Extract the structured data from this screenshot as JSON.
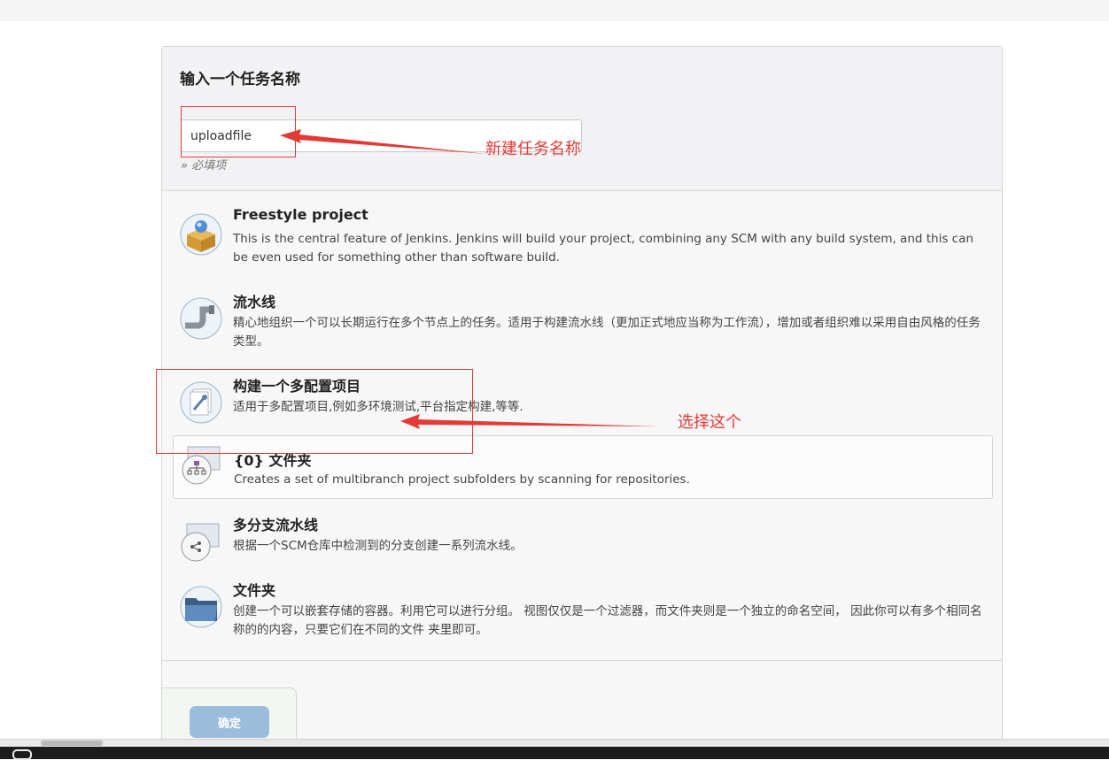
{
  "header": {
    "title": "输入一个任务名称",
    "name_value": "uploadfile",
    "required_hint": "» 必填项"
  },
  "project_types": [
    {
      "title": "Freestyle project",
      "description": "This is the central feature of Jenkins. Jenkins will build your project, combining any SCM with any build system, and this can be even used for something other than software build.",
      "icon": "freestyle-box-icon"
    },
    {
      "title": "流水线",
      "description": "精心地组织一个可以长期运行在多个节点上的任务。适用于构建流水线（更加正式地应当称为工作流），增加或者组织难以采用自由风格的任务类型。",
      "icon": "pipeline-icon"
    },
    {
      "title": "构建一个多配置项目",
      "description": "适用于多配置项目,例如多环境测试,平台指定构建,等等.",
      "icon": "multi-config-icon"
    },
    {
      "title": "{0} 文件夹",
      "description": "Creates a set of multibranch project subfolders by scanning for repositories.",
      "icon": "org-folder-icon"
    },
    {
      "title": "多分支流水线",
      "description": "根据一个SCM仓库中检测到的分支创建一系列流水线。",
      "icon": "multibranch-icon"
    },
    {
      "title": "文件夹",
      "description": "创建一个可以嵌套存储的容器。利用它可以进行分组。 视图仅仅是一个过滤器，而文件夹则是一个独立的命名空间， 因此你可以有多个相同名称的的内容，只要它们在不同的文件 夹里即可。",
      "icon": "folder-icon"
    }
  ],
  "footer": {
    "ok_label": "确定"
  },
  "annotations": {
    "name_note": "新建任务名称",
    "select_note": "选择这个",
    "color": "#e53935"
  }
}
